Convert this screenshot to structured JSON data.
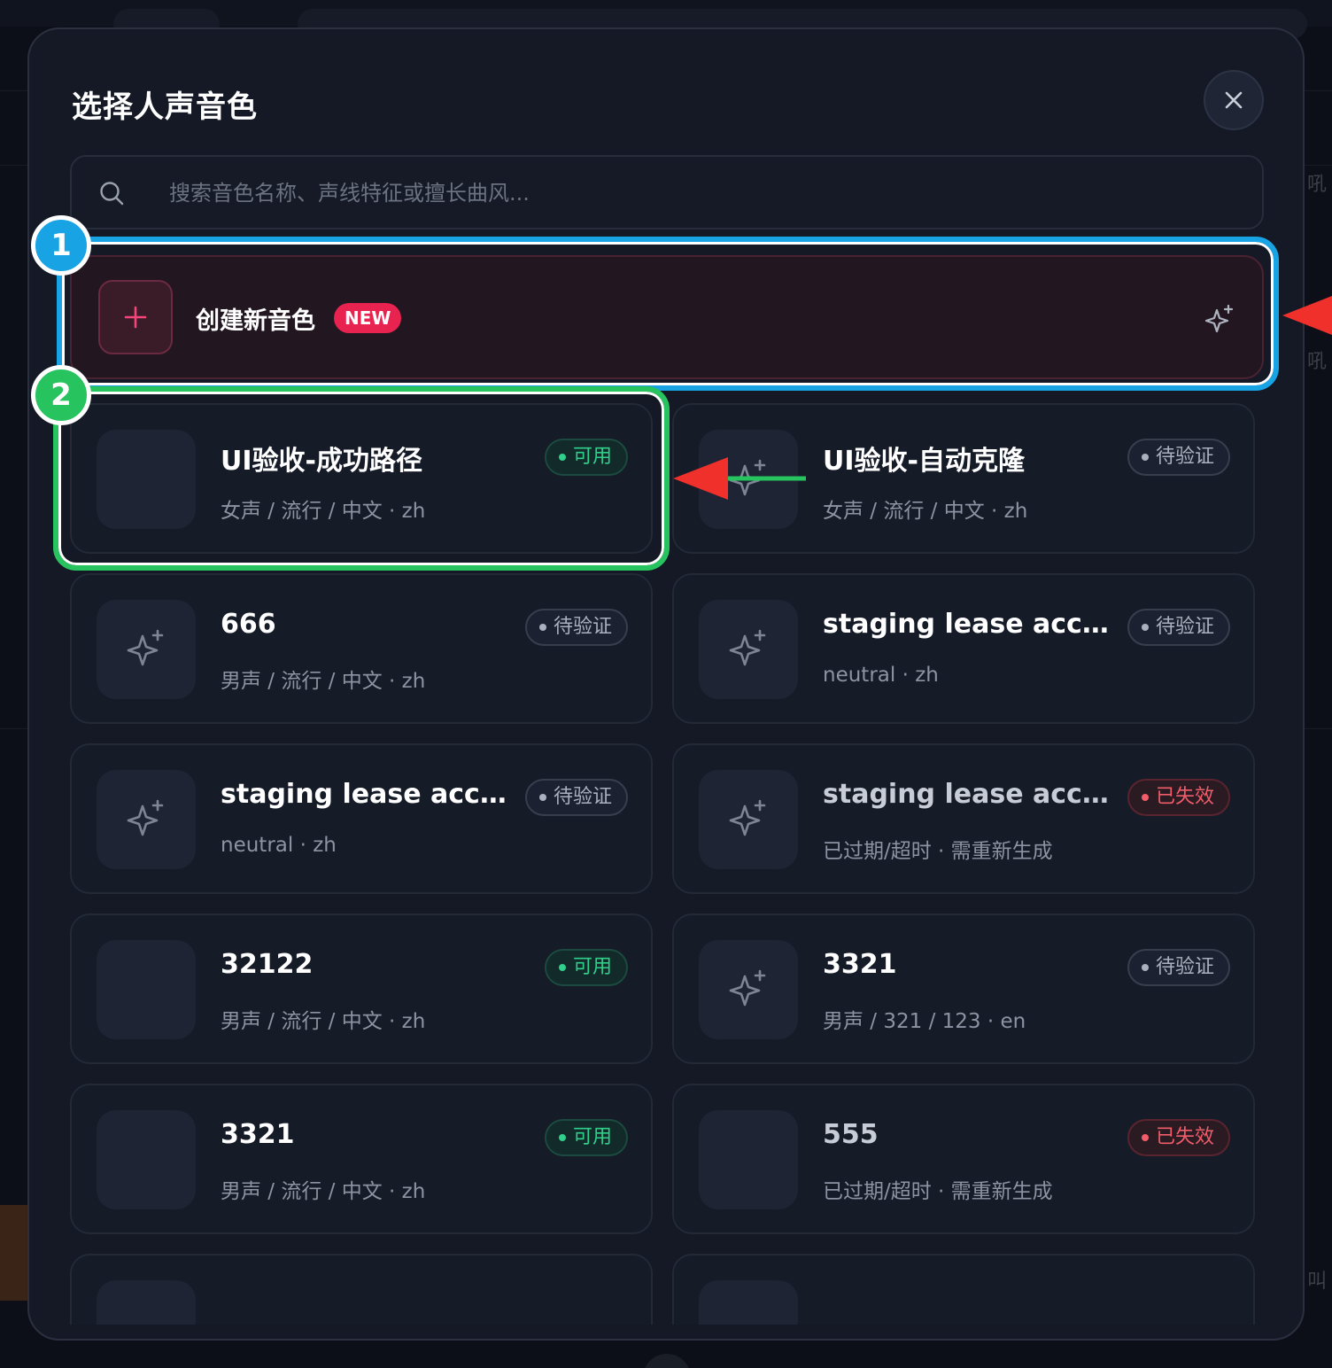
{
  "background": {
    "side_text_1": "吼",
    "side_text_2": "吼",
    "side_text_3": "叫"
  },
  "modal": {
    "title": "选择人声音色",
    "close_icon": "close-icon",
    "search": {
      "placeholder": "搜索音色名称、声线特征或擅长曲风...",
      "icon": "search-icon"
    },
    "create": {
      "label": "创建新音色",
      "badge": "NEW",
      "icon": "plus-icon",
      "accent": "#e8234f"
    }
  },
  "voices": [
    {
      "name": "UI验收-成功路径",
      "meta": "女声 / 流行 / 中文 · zh",
      "status": "可用",
      "status_type": "ok",
      "spark": false
    },
    {
      "name": "UI验收-自动克隆",
      "meta": "女声 / 流行 / 中文 · zh",
      "status": "待验证",
      "status_type": "pending",
      "spark": true
    },
    {
      "name": "666",
      "meta": "男声 / 流行 / 中文 · zh",
      "status": "待验证",
      "status_type": "pending",
      "spark": true
    },
    {
      "name": "staging lease accep...",
      "meta": "neutral · zh",
      "status": "待验证",
      "status_type": "pending",
      "spark": true
    },
    {
      "name": "staging lease accep...",
      "meta": "neutral · zh",
      "status": "待验证",
      "status_type": "pending",
      "spark": true
    },
    {
      "name": "staging lease accep...",
      "meta": "已过期/超时 · 需重新生成",
      "status": "已失效",
      "status_type": "expired",
      "spark": true
    },
    {
      "name": "32122",
      "meta": "男声 / 流行 / 中文 · zh",
      "status": "可用",
      "status_type": "ok",
      "spark": false
    },
    {
      "name": "3321",
      "meta": "男声 / 321 / 123 · en",
      "status": "待验证",
      "status_type": "pending",
      "spark": true
    },
    {
      "name": "3321",
      "meta": "男声 / 流行 / 中文 · zh",
      "status": "可用",
      "status_type": "ok",
      "spark": false
    },
    {
      "name": "555",
      "meta": "已过期/超时 · 需重新生成",
      "status": "已失效",
      "status_type": "expired",
      "spark": false
    }
  ],
  "annotations": {
    "marker_1": "1",
    "marker_2": "2",
    "colors": {
      "blue": "#18a3e4",
      "green": "#27c35e",
      "arrow": "#f0302a"
    }
  },
  "colors": {
    "modal_bg": "#141925",
    "card_bg": "#161b28",
    "status_ok": "#2fd18a",
    "status_pending": "#aab1be",
    "status_expired": "#f25d6a"
  }
}
